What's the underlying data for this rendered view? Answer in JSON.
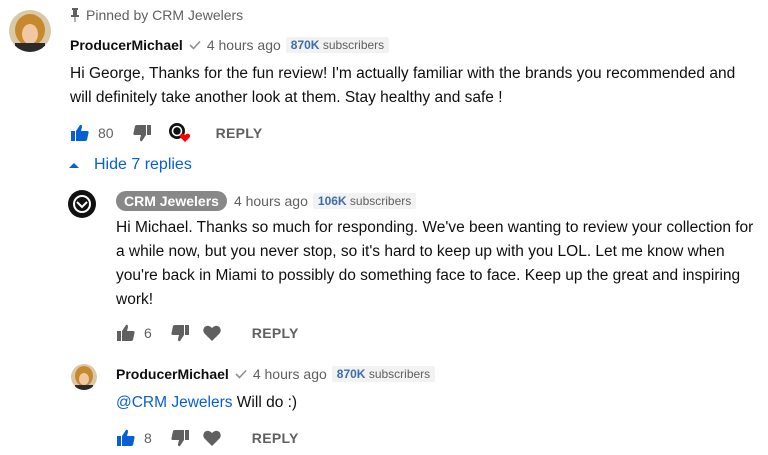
{
  "pinned": {
    "label": "Pinned by CRM Jewelers"
  },
  "comments": [
    {
      "author": "ProducerMichael",
      "time": "4 hours ago",
      "subscribers_count": "870K",
      "subscribers_word": "subscribers",
      "text": "Hi George, Thanks for the fun review! I'm actually familiar with the brands you recommended and will definitely take another look at them. Stay healthy and safe !",
      "likes": "80",
      "reply_label": "REPLY"
    }
  ],
  "hide_replies": {
    "label": "Hide 7 replies"
  },
  "replies": [
    {
      "author": "CRM Jewelers",
      "time": "4 hours ago",
      "subscribers_count": "106K",
      "subscribers_word": "subscribers",
      "text": "Hi Michael. Thanks so much for responding. We've been wanting to review your collection for a while now, but you never stop, so it's hard to keep up with you LOL. Let me know when you're back in Miami to possibly do something face to face. Keep up the great and inspiring work!",
      "likes": "6",
      "reply_label": "REPLY"
    },
    {
      "author": "ProducerMichael",
      "time": "4 hours ago",
      "subscribers_count": "870K",
      "subscribers_word": "subscribers",
      "mention": "@CRM Jewelers",
      "text": " Will do :)",
      "likes": "8",
      "reply_label": "REPLY"
    }
  ],
  "colors": {
    "link": "#065fd4",
    "heart": "#ff0000",
    "meta": "#606060",
    "badge_bg": "#f2f2f2"
  },
  "icons": [
    "pin-icon",
    "checkmark-icon",
    "thumbs-up-icon",
    "thumbs-down-icon",
    "creator-heart-icon",
    "heart-icon",
    "chevron-up-icon"
  ]
}
